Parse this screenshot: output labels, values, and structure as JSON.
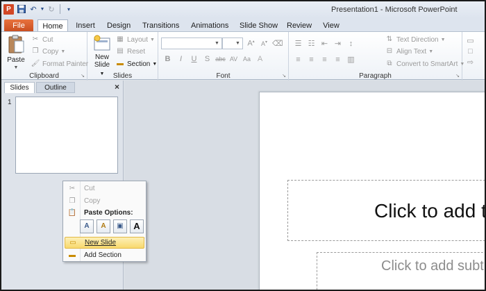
{
  "window": {
    "title": "Presentation1 - Microsoft PowerPoint",
    "app_icon": "P"
  },
  "qat": {
    "save_icon": "save-icon",
    "undo_icon": "undo-icon",
    "redo_icon": "redo-icon"
  },
  "tabs": [
    "File",
    "Home",
    "Insert",
    "Design",
    "Transitions",
    "Animations",
    "Slide Show",
    "Review",
    "View"
  ],
  "ribbon": {
    "clipboard": {
      "label": "Clipboard",
      "paste": "Paste",
      "cut": "Cut",
      "copy": "Copy",
      "format_painter": "Format Painter"
    },
    "slides": {
      "label": "Slides",
      "new_slide_1": "New",
      "new_slide_2": "Slide",
      "layout": "Layout",
      "reset": "Reset",
      "section": "Section"
    },
    "font": {
      "label": "Font"
    },
    "paragraph": {
      "label": "Paragraph",
      "text_direction": "Text Direction",
      "align_text": "Align Text",
      "convert_smartart": "Convert to SmartArt"
    }
  },
  "leftpane": {
    "tab_slides": "Slides",
    "tab_outline": "Outline",
    "close": "×",
    "slide_number": "1"
  },
  "context_menu": {
    "cut": "Cut",
    "copy": "Copy",
    "paste_options": "Paste Options:",
    "new_slide": "New Slide",
    "add_section": "Add Section"
  },
  "slide": {
    "title_placeholder": "Click to add title",
    "subtitle_placeholder": "Click to add subtitle"
  },
  "colors": {
    "file_tab": "#d24726",
    "highlight": "#f8d96e",
    "ribbon_bg": "#eef2f7"
  }
}
